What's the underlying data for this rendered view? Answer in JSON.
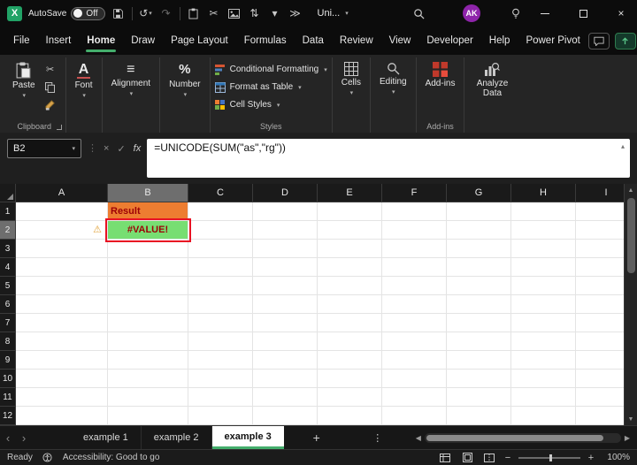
{
  "titlebar": {
    "autosave_label": "AutoSave",
    "autosave_state": "Off",
    "doc_title": "Uni...",
    "avatar": "AK"
  },
  "menubar": {
    "items": [
      "File",
      "Insert",
      "Home",
      "Draw",
      "Page Layout",
      "Formulas",
      "Data",
      "Review",
      "View",
      "Developer",
      "Help",
      "Power Pivot"
    ],
    "active": "Home"
  },
  "ribbon": {
    "paste": "Paste",
    "clipboard_group": "Clipboard",
    "font": "Font",
    "alignment": "Alignment",
    "number": "Number",
    "conditional_formatting": "Conditional Formatting",
    "format_as_table": "Format as Table",
    "cell_styles": "Cell Styles",
    "styles_group": "Styles",
    "cells": "Cells",
    "editing": "Editing",
    "addins": "Add-ins",
    "addins_group": "Add-ins",
    "analyze_data": "Analyze Data"
  },
  "formula_bar": {
    "name_box": "B2",
    "fx": "fx",
    "formula": "=UNICODE(SUM(\"as\",\"rg\"))"
  },
  "grid": {
    "columns": [
      "A",
      "B",
      "C",
      "D",
      "E",
      "F",
      "G",
      "H",
      "I"
    ],
    "rows": [
      "1",
      "2",
      "3",
      "4",
      "5",
      "6",
      "7",
      "8",
      "9",
      "10",
      "11",
      "12"
    ],
    "selected": {
      "col": "B",
      "row": "2"
    },
    "cells": {
      "B1": {
        "text": "Result",
        "kind": "result-header"
      },
      "B2": {
        "text": "#VALUE!",
        "kind": "error-value"
      },
      "A2": {
        "kind": "error-flag"
      }
    }
  },
  "tabs": {
    "items": [
      "example 1",
      "example 2",
      "example 3"
    ],
    "active": "example 3"
  },
  "statusbar": {
    "mode": "Ready",
    "accessibility": "Accessibility: Good to go",
    "zoom": "100%"
  },
  "icons": {
    "excel_logo": "X",
    "undo": "↺",
    "redo": "↷",
    "cut": "✂",
    "sort": "⇅",
    "dropdown": "▾",
    "overflow": "≫",
    "close": "×",
    "cancel": "×",
    "enter": "✓",
    "handle": "⋮",
    "collapse": "▴",
    "warning": "⚠",
    "alignment_glyph": "≡",
    "font_glyph": "A",
    "percent_glyph": "%",
    "scroll_up": "▲",
    "scroll_down": "▼",
    "scroll_left": "◀",
    "scroll_right": "▶",
    "tab_prev": "‹",
    "tab_next": "›",
    "add_sheet": "+",
    "tab_menu": "⋮",
    "zoom_out": "−",
    "zoom_in": "+"
  },
  "colors": {
    "accent_green": "#44AE6C",
    "excel_green": "#21A366",
    "result_fill": "#ED7D31",
    "result_text": "#9C0006",
    "error_fill": "#77DE72",
    "error_text": "#9C0006",
    "annotation_red": "#E81123",
    "avatar_purple": "#8E24AA"
  }
}
